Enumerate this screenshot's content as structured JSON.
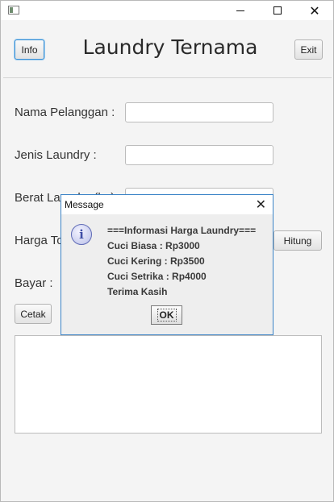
{
  "window": {
    "controls": {
      "minimize": "",
      "maximize": "",
      "close": "✕"
    }
  },
  "header": {
    "title": "Laundry Ternama",
    "info_label": "Info",
    "exit_label": "Exit"
  },
  "form": {
    "customer_name_label": "Nama Pelanggan :",
    "laundry_type_label": "Jenis Laundry :",
    "weight_label": "Berat Laundry (kg) :",
    "total_price_label": "Harga Total :",
    "pay_label": "Bayar :",
    "calculate_label": "Hitung",
    "print_label": "Cetak"
  },
  "dialog": {
    "title": "Message",
    "close": "✕",
    "icon": "i",
    "lines": [
      "===Informasi Harga Laundry===",
      "Cuci Biasa : Rp3000",
      "Cuci Kering : Rp3500",
      "Cuci Setrika : Rp4000",
      "Terima Kasih"
    ],
    "ok_label": "OK"
  },
  "colors": {
    "dialog_border": "#3c84c7",
    "focus_ring": "#3a8fd3",
    "window_bg": "#f4f4f4"
  }
}
